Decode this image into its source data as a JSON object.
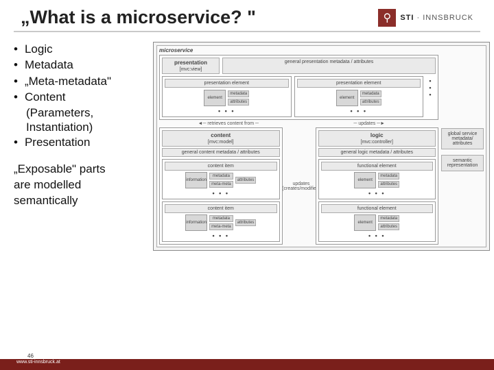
{
  "header": {
    "title": "„What is a microservice? \"",
    "logo": {
      "icon_glyph": "⚲",
      "brand_bold": "STI",
      "brand_rest": " · INNSBRUCK"
    }
  },
  "bullets": {
    "i0": "Logic",
    "i1": "Metadata",
    "i2": "„Meta-metadata\"",
    "i3": "Content",
    "i3a": "(Parameters,",
    "i3b": "Instantiation)",
    "i4": "Presentation"
  },
  "exposable": {
    "l1": "„Exposable\" parts",
    "l2": "are modelled",
    "l3": "semantically"
  },
  "diagram": {
    "root": "microservice",
    "presentation": {
      "title": "presentation",
      "sub": "[mvc:view]",
      "meta": "general presentation metadata / attributes",
      "pe": "presentation element",
      "element": "element",
      "metadata": "metadata",
      "attributes": "attributes"
    },
    "arrows": {
      "retrieves": "retrieves content from",
      "updates": "updates",
      "updates_db": "updates (creates/modifies)"
    },
    "content": {
      "title": "content",
      "sub": "[mvc:model]",
      "meta": "general content metadata / attributes",
      "ci": "content item",
      "information": "information",
      "metadata": "metadata",
      "attributes": "attributes",
      "meta_meta": "meta-meta"
    },
    "logic": {
      "title": "logic",
      "sub": "[mvc:controller]",
      "meta": "general logic metadata / attributes",
      "fe": "functional element",
      "element": "element",
      "metadata": "metadata",
      "attributes": "attributes"
    },
    "side": {
      "global": "global service metadata/ attributes",
      "semantic": "semantic representation"
    },
    "ellipsis": "• • •"
  },
  "footer": {
    "page": "46",
    "url": "www.sti-innsbruck.at"
  }
}
